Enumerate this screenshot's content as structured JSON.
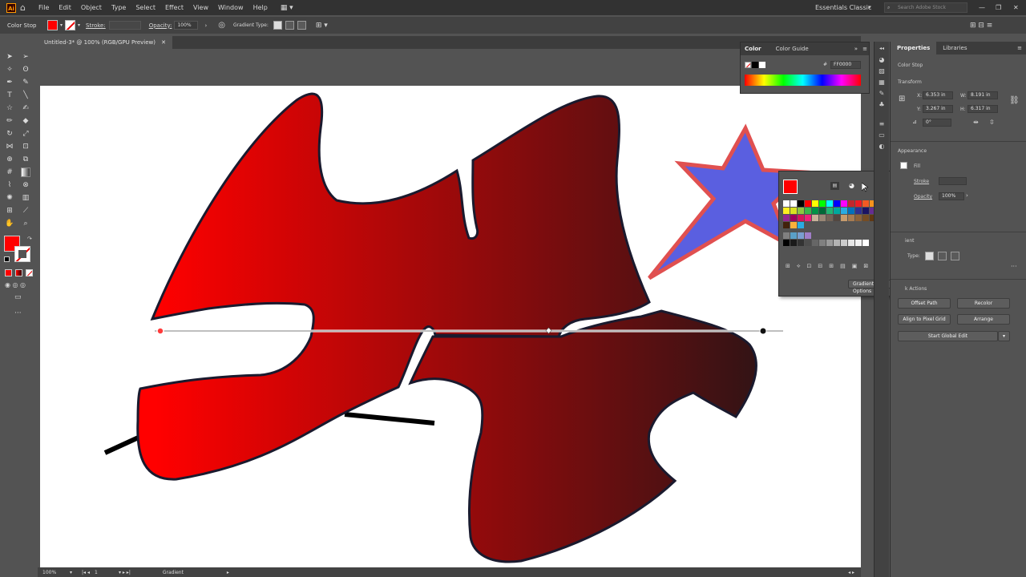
{
  "app": {
    "logo_text": "Ai",
    "menus": [
      "File",
      "Edit",
      "Object",
      "Type",
      "Select",
      "Effect",
      "View",
      "Window",
      "Help"
    ],
    "workspace": "Essentials Classic",
    "search_placeholder": "Search Adobe Stock"
  },
  "control_bar": {
    "context_label": "Color Stop",
    "stroke_label": "Stroke:",
    "opacity_label": "Opacity:",
    "opacity_value": "100%",
    "gradient_type_label": "Gradient Type:"
  },
  "document": {
    "tab_title": "Untitled-3* @ 100% (RGB/GPU Preview)"
  },
  "color_panel": {
    "tabs": [
      "Color",
      "Color Guide"
    ],
    "hex_label": "#",
    "hex_value": "FF0000"
  },
  "swatch_popup": {
    "gradient_options_button": "Gradient Options"
  },
  "properties_panel": {
    "tabs": [
      "Properties",
      "Libraries"
    ],
    "selection_label": "Color Stop",
    "transform_title": "Transform",
    "x_label": "X:",
    "x_value": "6.353 in",
    "y_label": "Y:",
    "y_value": "3.267 in",
    "w_label": "W:",
    "w_value": "8.191 in",
    "h_label": "H:",
    "h_value": "6.317 in",
    "rotation_value": "0°",
    "appearance_title": "Appearance",
    "fill_label": "Fill",
    "stroke_label": "Stroke",
    "opacity_label": "Opacity",
    "opacity_value": "100%",
    "gradient_title": "ient",
    "type_label": "Type:",
    "quick_actions_title": "k Actions",
    "buttons": {
      "offset_path": "Offset Path",
      "recolor": "Recolor",
      "align_pixel_grid": "Align to Pixel Grid",
      "arrange": "Arrange",
      "start_global_edit": "Start Global Edit"
    }
  },
  "status_bar": {
    "zoom": "100%",
    "artboard_number": "1",
    "tool_name": "Gradient"
  },
  "colors": {
    "fill_swatch": "#ff0000",
    "star_fill": "#5a5fe0",
    "star_stroke": "#e05050",
    "gradient_start": "#ff0000",
    "gradient_end": "#2a1416"
  }
}
